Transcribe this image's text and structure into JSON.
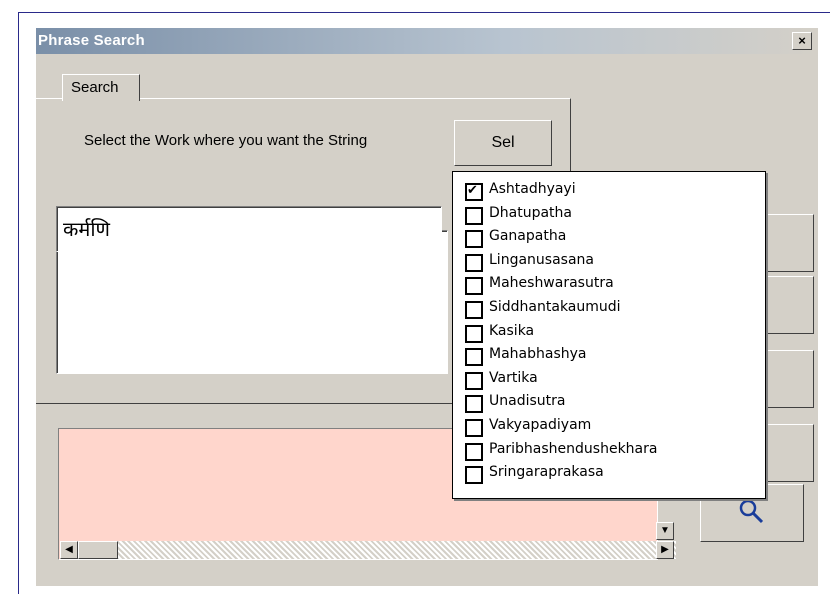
{
  "window": {
    "title": "Phrase Search",
    "close_glyph": "×"
  },
  "tabs": [
    {
      "label": "Search"
    }
  ],
  "search": {
    "prompt": "Select the Work where you want the String",
    "sel_button_label": "Sel",
    "input_value": "कर्मणि"
  },
  "works_dropdown": {
    "options": [
      {
        "label": "Ashtadhyayi",
        "checked": true
      },
      {
        "label": "Dhatupatha",
        "checked": false
      },
      {
        "label": "Ganapatha",
        "checked": false
      },
      {
        "label": "Linganusasana",
        "checked": false
      },
      {
        "label": "Maheshwarasutra",
        "checked": false
      },
      {
        "label": "Siddhantakaumudi",
        "checked": false
      },
      {
        "label": "Kasika",
        "checked": false
      },
      {
        "label": "Mahabhashya",
        "checked": false
      },
      {
        "label": "Vartika",
        "checked": false
      },
      {
        "label": "Unadisutra",
        "checked": false
      },
      {
        "label": "Vakyapadiyam",
        "checked": false
      },
      {
        "label": "Paribhashendushekhara",
        "checked": false
      },
      {
        "label": "Sringaraprakasa",
        "checked": false
      }
    ]
  },
  "colors": {
    "result_background": "#ffd6cc",
    "title_bar": "#7a8fa8"
  },
  "icons": {
    "search_button_icon": "magnifier-icon"
  }
}
